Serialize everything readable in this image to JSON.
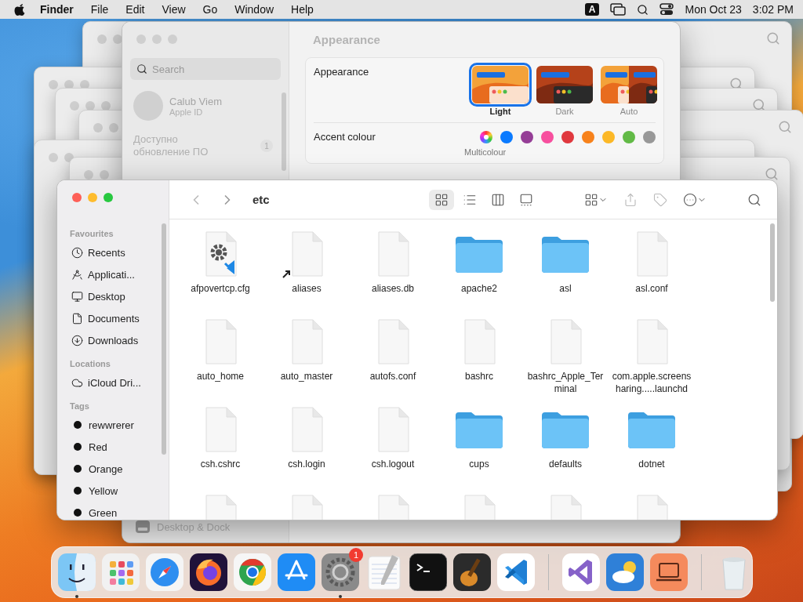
{
  "menu_bar": {
    "app": "Finder",
    "menus": [
      "File",
      "Edit",
      "View",
      "Go",
      "Window",
      "Help"
    ],
    "input_source": "A",
    "date": "Mon Oct 23",
    "time": "3:02 PM"
  },
  "settings_window": {
    "search": {
      "placeholder": "Search"
    },
    "account": {
      "name": "Calub Viem",
      "subtitle": "Apple ID"
    },
    "update": {
      "label": "Доступно обновление ПО",
      "count": "1"
    },
    "bottom_item": "Desktop & Dock",
    "title": "Appearance",
    "appearance": {
      "label": "Appearance",
      "options": [
        {
          "label": "Light",
          "kind": "light",
          "selected": true
        },
        {
          "label": "Dark",
          "kind": "dark",
          "selected": false
        },
        {
          "label": "Auto",
          "kind": "auto",
          "selected": false
        }
      ]
    },
    "accent": {
      "label": "Accent colour",
      "selected_name": "Multicolour",
      "colors": [
        {
          "kind": "multi",
          "selected": true
        },
        {
          "kind": "solid",
          "color": "#0a7aff",
          "selected": false
        },
        {
          "kind": "solid",
          "color": "#953d96",
          "selected": false
        },
        {
          "kind": "solid",
          "color": "#f74f9e",
          "selected": false
        },
        {
          "kind": "solid",
          "color": "#e0383e",
          "selected": false
        },
        {
          "kind": "solid",
          "color": "#f7821b",
          "selected": false
        },
        {
          "kind": "solid",
          "color": "#fcb827",
          "selected": false
        },
        {
          "kind": "solid",
          "color": "#62ba46",
          "selected": false
        },
        {
          "kind": "solid",
          "color": "#989898",
          "selected": false
        }
      ]
    }
  },
  "finder": {
    "path": "etc",
    "view_modes": [
      {
        "kind": "icons",
        "selected": true
      },
      {
        "kind": "list",
        "selected": false
      },
      {
        "kind": "columns",
        "selected": false
      },
      {
        "kind": "gallery",
        "selected": false
      }
    ],
    "sidebar": [
      {
        "heading": "Favourites",
        "items": [
          {
            "label": "Recents",
            "kind": "clock"
          },
          {
            "label": "Applicati...",
            "kind": "apps"
          },
          {
            "label": "Desktop",
            "kind": "desktop"
          },
          {
            "label": "Documents",
            "kind": "document"
          },
          {
            "label": "Downloads",
            "kind": "download"
          }
        ]
      },
      {
        "heading": "Locations",
        "items": [
          {
            "label": "iCloud Dri...",
            "kind": "cloud"
          }
        ]
      },
      {
        "heading": "Tags",
        "items": [
          {
            "label": "rewwrerer",
            "kind": "tag"
          },
          {
            "label": "Red",
            "kind": "tag"
          },
          {
            "label": "Orange",
            "kind": "tag"
          },
          {
            "label": "Yellow",
            "kind": "tag"
          },
          {
            "label": "Green",
            "kind": "tag"
          }
        ]
      }
    ],
    "files": [
      {
        "name": "afpovertcp.cfg",
        "kind": "config"
      },
      {
        "name": "aliases",
        "kind": "alias"
      },
      {
        "name": "aliases.db",
        "kind": "document"
      },
      {
        "name": "apache2",
        "kind": "folder"
      },
      {
        "name": "asl",
        "kind": "folder"
      },
      {
        "name": "asl.conf",
        "kind": "document"
      },
      {
        "name": "auto_home",
        "kind": "document"
      },
      {
        "name": "auto_master",
        "kind": "document"
      },
      {
        "name": "autofs.conf",
        "kind": "document"
      },
      {
        "name": "bashrc",
        "kind": "document"
      },
      {
        "name": "bashrc_Apple_Terminal",
        "kind": "document"
      },
      {
        "name": "com.apple.screensharing.....launchd",
        "kind": "document"
      },
      {
        "name": "csh.cshrc",
        "kind": "document"
      },
      {
        "name": "csh.login",
        "kind": "document"
      },
      {
        "name": "csh.logout",
        "kind": "document"
      },
      {
        "name": "cups",
        "kind": "folder"
      },
      {
        "name": "defaults",
        "kind": "folder"
      },
      {
        "name": "dotnet",
        "kind": "folder"
      },
      {
        "kind": "document"
      },
      {
        "kind": "document"
      },
      {
        "kind": "document"
      },
      {
        "kind": "document"
      },
      {
        "kind": "document"
      },
      {
        "kind": "document"
      }
    ]
  },
  "dock": {
    "apps": [
      {
        "kind": "finder",
        "running": true
      },
      {
        "kind": "launchpad",
        "running": false
      },
      {
        "kind": "safari",
        "running": false
      },
      {
        "kind": "firefox",
        "running": false
      },
      {
        "kind": "chrome",
        "running": false
      },
      {
        "kind": "appstore",
        "running": false
      },
      {
        "kind": "settings",
        "running": true,
        "badge": "1"
      },
      {
        "kind": "textedit",
        "running": false
      },
      {
        "kind": "terminal",
        "running": false
      },
      {
        "kind": "garageband",
        "running": false
      },
      {
        "kind": "vscode",
        "running": false
      },
      {
        "kind": "separator"
      },
      {
        "kind": "visualstudio",
        "running": false
      },
      {
        "kind": "weather",
        "running": false
      },
      {
        "kind": "screen",
        "running": false
      },
      {
        "kind": "separator"
      },
      {
        "kind": "trash",
        "running": false
      }
    ]
  }
}
